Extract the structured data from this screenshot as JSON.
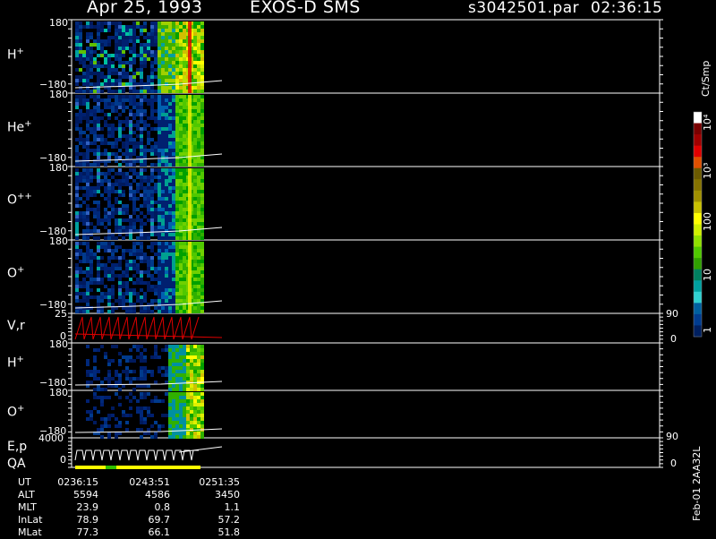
{
  "header": {
    "date": "Apr 25, 1993",
    "instrument": "EXOS-D SMS",
    "file": "s3042501.par",
    "time": "02:36:15"
  },
  "colorbar": {
    "unit": "Ct/Smp",
    "tick_labels": [
      "10⁴",
      "10³",
      "100",
      "10",
      "1"
    ],
    "colors": [
      "#ffffff",
      "#7a0000",
      "#a00000",
      "#e00000",
      "#e05000",
      "#6b5a00",
      "#857300",
      "#a09000",
      "#c8c000",
      "#ffff00",
      "#d0f000",
      "#90e000",
      "#50c800",
      "#30a000",
      "#008060",
      "#00a0a0",
      "#30d0d0",
      "#0060a0",
      "#003c90",
      "#002060"
    ]
  },
  "panels": [
    {
      "species": "H",
      "charge": "+",
      "ytop": "180",
      "ybot": "−180"
    },
    {
      "species": "He",
      "charge": "+",
      "ytop": "180",
      "ybot": "−180"
    },
    {
      "species": "O",
      "charge": "++",
      "ytop": "180",
      "ybot": "−180"
    },
    {
      "species": "O",
      "charge": "+",
      "ytop": "180",
      "ybot": "−180"
    },
    {
      "species": "V,r",
      "charge": "",
      "ytop": "25",
      "ybot": "0",
      "yright_top": "90",
      "yright_bot": "0"
    },
    {
      "species": "H",
      "charge": "+",
      "ytop": "180",
      "ybot": "−180"
    },
    {
      "species": "O",
      "charge": "+",
      "ytop": "180",
      "ybot": "−180"
    },
    {
      "species": "E,p",
      "charge": "",
      "label2": "QA",
      "ytop": "4000",
      "ybot": "0",
      "yright_top": "90",
      "yright_bot": "0"
    }
  ],
  "footer": {
    "row_labels": [
      "UT",
      "ALT",
      "MLT",
      "InLat",
      "MLat"
    ],
    "columns": [
      [
        "0236:15",
        "5594",
        "23.9",
        "78.9",
        "77.3"
      ],
      [
        "0243:51",
        "4586",
        "0.8",
        "69.7",
        "66.1"
      ],
      [
        "0251:35",
        "3450",
        "1.1",
        "57.2",
        "51.8"
      ]
    ],
    "side_stamp": "Feb-01 2AA32L"
  },
  "chart_data": {
    "type": "heatmap",
    "title": "Apr 25, 1993   EXOS-D SMS",
    "x": [
      "0236:15",
      "0243:51",
      "0251:35"
    ],
    "panels": [
      "H+",
      "He+",
      "O++",
      "O+",
      "V,r",
      "H+",
      "O+",
      "E,p QA"
    ],
    "ylim_pitch": [
      -180,
      180
    ],
    "colorbar_scale": "log",
    "colorbar_range": [
      1,
      10000
    ],
    "colorbar_unit": "Ct/Smp"
  }
}
